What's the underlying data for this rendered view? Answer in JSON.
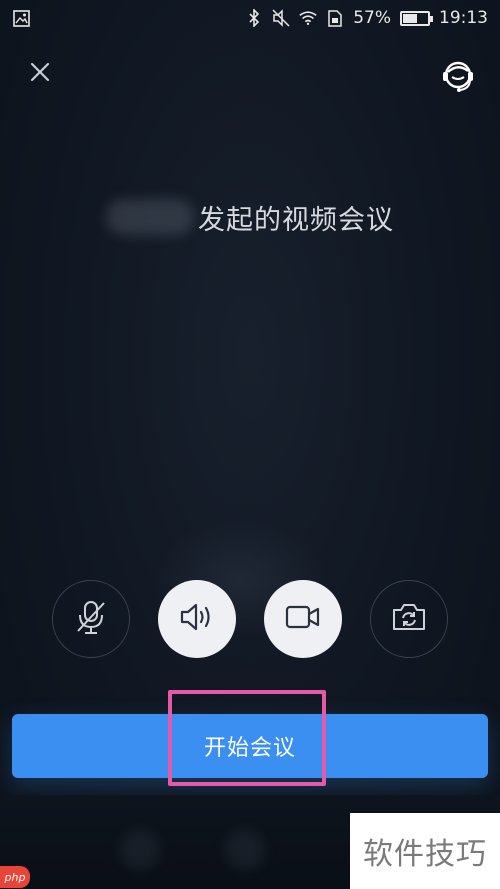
{
  "status_bar": {
    "battery_percent": "57%",
    "battery_level": 0.57,
    "time": "19:13",
    "icons": [
      "gallery-icon",
      "bluetooth-icon",
      "mute-icon",
      "wifi-icon",
      "sim-icon",
      "battery-icon"
    ]
  },
  "header": {
    "close_icon": "close-icon",
    "support_icon": "customer-service-icon"
  },
  "meeting": {
    "title": "发起的视频会议"
  },
  "controls": [
    {
      "icon": "microphone-off-icon",
      "state": "off"
    },
    {
      "icon": "speaker-icon",
      "state": "on"
    },
    {
      "icon": "camera-icon",
      "state": "on"
    },
    {
      "icon": "switch-camera-icon",
      "state": "off"
    }
  ],
  "start_button": {
    "label": "开始会议"
  },
  "watermark": {
    "text": "软件技巧",
    "logo_text": "php"
  },
  "colors": {
    "background": "#101722",
    "accent": "#3a8ff0",
    "highlight": "#e45aa8",
    "control_filled": "#eef0f3"
  }
}
